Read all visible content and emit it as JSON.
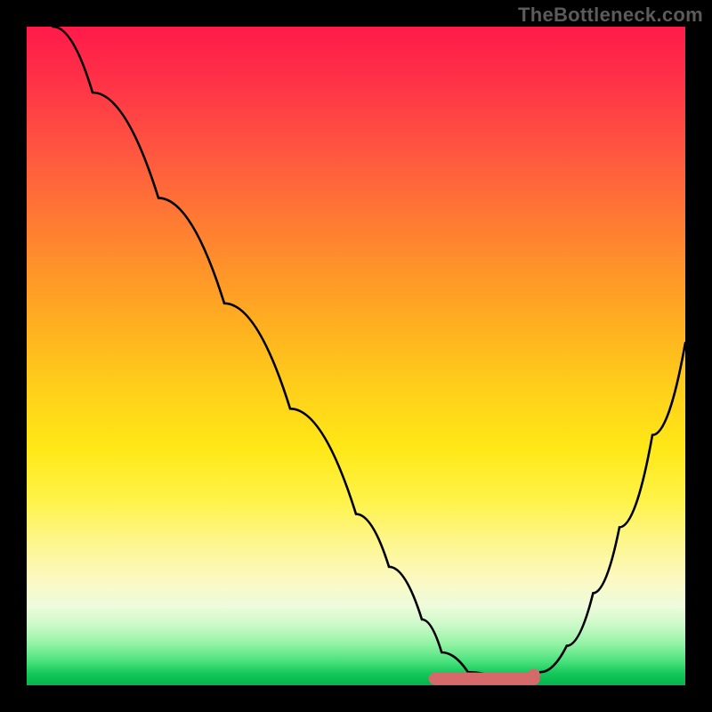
{
  "watermark": "TheBottleneck.com",
  "chart_data": {
    "type": "line",
    "title": "",
    "xlabel": "",
    "ylabel": "",
    "xlim": [
      0,
      100
    ],
    "ylim": [
      0,
      100
    ],
    "series": [
      {
        "name": "curve",
        "x": [
          4,
          10,
          20,
          30,
          40,
          50,
          55,
          60,
          63,
          67,
          72,
          75,
          78,
          82,
          86,
          90,
          95,
          100
        ],
        "values": [
          100,
          90,
          74,
          58,
          42,
          26,
          18,
          10,
          5,
          2,
          1,
          1,
          2,
          6,
          14,
          24,
          38,
          52
        ]
      }
    ],
    "markers": [
      {
        "name": "flat-pink-band",
        "x_start": 62,
        "x_end": 77,
        "y": 1
      }
    ],
    "gradient_stops": [
      {
        "pos": 0,
        "color": "#ff1a4a"
      },
      {
        "pos": 50,
        "color": "#ffd21a"
      },
      {
        "pos": 80,
        "color": "#fbf9c2"
      },
      {
        "pos": 100,
        "color": "#05b44a"
      }
    ]
  }
}
